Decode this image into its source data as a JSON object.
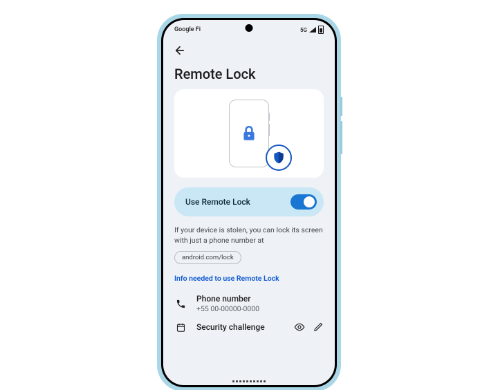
{
  "status": {
    "carrier": "Google Fi",
    "network": "5G"
  },
  "page": {
    "title": "Remote Lock"
  },
  "toggle": {
    "label": "Use Remote Lock",
    "enabled": true
  },
  "description": {
    "text": "If your device is stolen, you can lock its screen with just a phone number at",
    "url_chip": "android.com/lock"
  },
  "section": {
    "header": "Info needed to use Remote Lock"
  },
  "rows": {
    "phone": {
      "title": "Phone number",
      "value": "+55 00-00000-0000"
    },
    "security": {
      "title": "Security challenge"
    }
  },
  "icons": {
    "back": "arrow-left",
    "lock": "lock",
    "shield": "shield",
    "phone": "phone",
    "calendar": "calendar",
    "eye": "visibility",
    "edit": "edit"
  }
}
